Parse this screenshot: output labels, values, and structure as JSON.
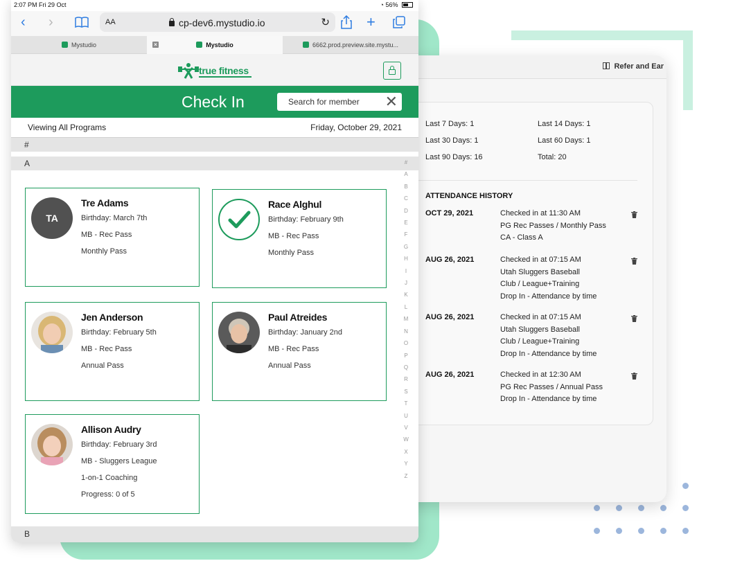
{
  "status_bar": {
    "time_date": "2:07 PM   Fri 29 Oct",
    "battery": "56%"
  },
  "browser": {
    "url_aa": "AA",
    "url": "cp-dev6.mystudio.io",
    "tabs": [
      {
        "label": "Mystudio",
        "active": false
      },
      {
        "label": "Mystudio",
        "active": true
      },
      {
        "label": "6662.prod.preview.site.mystu...",
        "active": false
      }
    ]
  },
  "app": {
    "logo_text": "true fitness",
    "page_title": "Check In",
    "search_placeholder": "Search for member",
    "viewing_label": "Viewing All Programs",
    "date": "Friday, October 29, 2021",
    "sections": {
      "hash": "#",
      "a": "A",
      "b": "B"
    },
    "alphabet": [
      "#",
      "A",
      "B",
      "C",
      "D",
      "E",
      "F",
      "G",
      "H",
      "I",
      "J",
      "K",
      "L",
      "M",
      "N",
      "O",
      "P",
      "Q",
      "R",
      "S",
      "T",
      "U",
      "V",
      "W",
      "X",
      "Y",
      "Z"
    ],
    "members": [
      {
        "name": "Tre Adams",
        "initials": "TA",
        "avatar": "initials",
        "lines": [
          "Birthday: March 7th",
          "MB - Rec Pass",
          "Monthly Pass"
        ]
      },
      {
        "name": "Race Alghul",
        "avatar": "checked",
        "lines": [
          "Birthday: February 9th",
          "MB - Rec Pass",
          "Monthly Pass"
        ]
      },
      {
        "name": "Jen Anderson",
        "avatar": "photo",
        "lines": [
          "Birthday: February 5th",
          "MB - Rec Pass",
          "Annual Pass"
        ]
      },
      {
        "name": "Paul Atreides",
        "avatar": "photo",
        "lines": [
          "Birthday: January 2nd",
          "MB - Rec Pass",
          "Annual Pass"
        ]
      },
      {
        "name": "Allison Audry",
        "avatar": "photo",
        "lines": [
          "Birthday: February 3rd",
          "MB - Sluggers League",
          "1-on-1 Coaching",
          "Progress:  0 of 5"
        ]
      }
    ]
  },
  "side_panel": {
    "refer_label": "Refer and Ear",
    "stats": {
      "last7": "Last 7 Days: 1",
      "last14": "Last 14 Days: 1",
      "last30": "Last 30 Days: 1",
      "last60": "Last 60 Days: 1",
      "last90": "Last 90 Days: 16",
      "total": "Total: 20"
    },
    "history_title": "ATTENDANCE HISTORY",
    "history": [
      {
        "date": "OCT 29, 2021",
        "lines": [
          "Checked in at 11:30 AM",
          "PG Rec Passes / Monthly Pass",
          "CA - Class A"
        ]
      },
      {
        "date": "AUG 26, 2021",
        "lines": [
          "Checked in at 07:15 AM",
          "Utah Sluggers Baseball",
          "Club / League+Training",
          "Drop In - Attendance by time"
        ]
      },
      {
        "date": "AUG 26, 2021",
        "lines": [
          "Checked in at 07:15 AM",
          "Utah Sluggers Baseball",
          "Club / League+Training",
          "Drop In - Attendance by time"
        ]
      },
      {
        "date": "AUG 26, 2021",
        "lines": [
          "Checked in at 12:30 AM",
          "PG Rec Passes / Annual Pass",
          "Drop In - Attendance by time"
        ]
      }
    ]
  },
  "colors": {
    "brand_green": "#1d9b5c",
    "deco_green": "#8fe3c0",
    "deco_dots": "#9cb6dc"
  }
}
